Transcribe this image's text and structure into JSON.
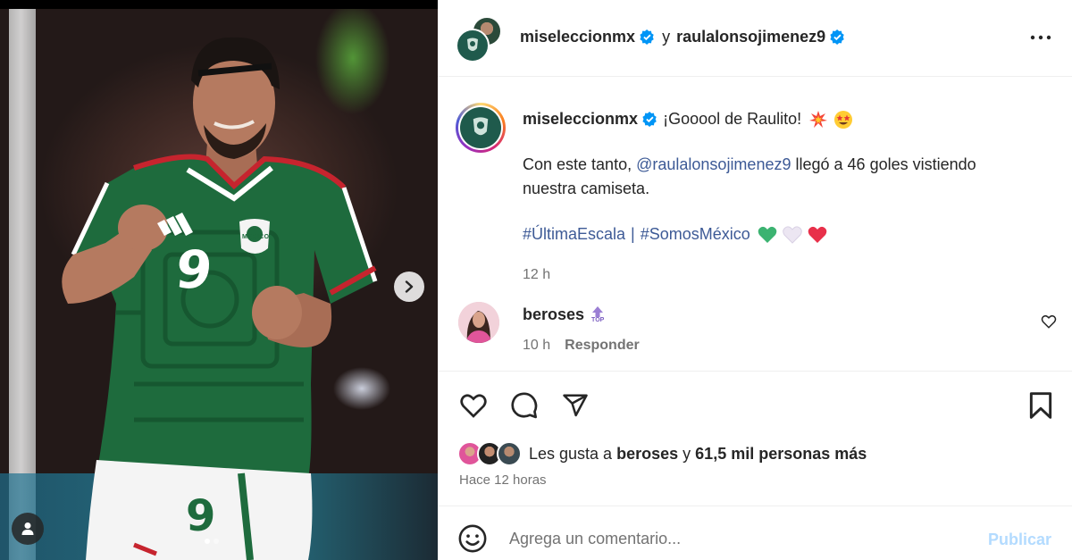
{
  "header": {
    "account_1": "miseleccionmx",
    "separator": "y",
    "account_2": "raulalonsojimenez9",
    "more_icon": "more-horizontal-icon"
  },
  "caption": {
    "username": "miseleccionmx",
    "headline": "¡Gooool de Raulito!",
    "body_prefix": "Con este tanto,",
    "mention": "@raulalonsojimenez9",
    "body_suffix": "llegó a 46 goles vistiendo",
    "body_line2": "nuestra camiseta.",
    "hashtag_1": "#ÚltimaEscala",
    "tag_separator": "|",
    "hashtag_2": "#SomosMéxico",
    "time": "12 h",
    "emojis_headline": [
      "collision-emoji",
      "star-struck-emoji"
    ],
    "emojis_tags": [
      "green-heart-emoji",
      "white-heart-emoji",
      "red-heart-emoji"
    ]
  },
  "comment": {
    "username": "beroses",
    "badge": "TOP",
    "time": "10 h",
    "reply_label": "Responder"
  },
  "likes": {
    "prefix": "Les gusta a",
    "first_liker": "beroses",
    "connector": "y",
    "others": "61,5 mil personas más",
    "posted": "Hace 12 horas"
  },
  "composer": {
    "placeholder": "Agrega un comentario...",
    "post_label": "Publicar"
  },
  "media": {
    "jersey_number": "9",
    "crest_text": "MEXICO",
    "carousel": {
      "count": 2,
      "active": 1
    }
  },
  "colors": {
    "link": "#385185",
    "secondary_text": "#737373",
    "verified": "#0095f6",
    "post_disabled": "#b3dbff",
    "jersey_green": "#1e6b3d"
  }
}
